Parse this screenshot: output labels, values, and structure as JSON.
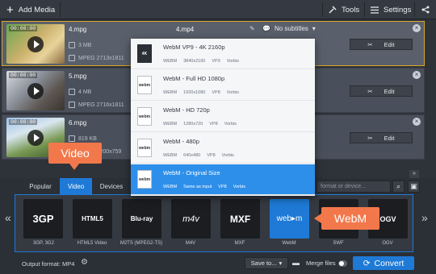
{
  "toolbar": {
    "add_media": "Add Media",
    "tools": "Tools",
    "settings": "Settings"
  },
  "files": [
    {
      "time": "00:00:00",
      "name": "4.mpg",
      "size": "3 MB",
      "info": "MPEG 2713x1811",
      "output": "4.mp4",
      "subtitles": "No subtitles",
      "edit": "Edit"
    },
    {
      "time": "00:00:00",
      "name": "5.mpg",
      "size": "4 MB",
      "info": "MPEG 2716x1811",
      "edit": "Edit"
    },
    {
      "time": "00:00:00",
      "name": "6.mpg",
      "size": "819 KB",
      "info": "MPEG 1200x759",
      "edit": "Edit"
    }
  ],
  "dropdown": [
    {
      "icon": "4K",
      "title": "WebM VP9 - 4K 2160p",
      "specs": [
        "WEBM",
        "3840x2160",
        "VP9",
        "Vorbis"
      ]
    },
    {
      "icon": "webm",
      "title": "WebM - Full HD 1080p",
      "specs": [
        "WEBM",
        "1920x1080",
        "VP8",
        "Vorbis"
      ]
    },
    {
      "icon": "webm",
      "title": "WebM - HD 720p",
      "specs": [
        "WEBM",
        "1280x720",
        "VP8",
        "Vorbis"
      ]
    },
    {
      "icon": "webm",
      "title": "WebM - 480p",
      "specs": [
        "WEBM",
        "640x480",
        "VP8",
        "Vorbis"
      ]
    },
    {
      "icon": "webm",
      "title": "WebM - Original Size",
      "specs": [
        "WEBM",
        "Same as input",
        "VP8",
        "Vorbis"
      ]
    }
  ],
  "tabs": [
    "Popular",
    "Video",
    "Devices"
  ],
  "search_placeholder": "format or device...",
  "formats": [
    {
      "icon": "3GP",
      "label": "3GP, 3G2"
    },
    {
      "icon": "HTML5",
      "label": "HTML5 Video"
    },
    {
      "icon": "Blu-ray",
      "label": "M2TS (MPEG2-TS)"
    },
    {
      "icon": "m4v",
      "label": "M4V"
    },
    {
      "icon": "MXF",
      "label": "MXF"
    },
    {
      "icon": "web▸m",
      "label": "WebM"
    },
    {
      "icon": "SWF",
      "label": "SWF"
    },
    {
      "icon": "OGV",
      "label": "OGV"
    }
  ],
  "callouts": {
    "video": "Video",
    "webm": "WebM"
  },
  "bottom": {
    "output_format": "Output format: MP4",
    "save_to": "Save to...",
    "merge_files": "Merge files",
    "convert": "Convert"
  },
  "colors": {
    "accent": "#1e7ad6",
    "callout": "#f2784b",
    "selection_border": "#d9a62a"
  }
}
